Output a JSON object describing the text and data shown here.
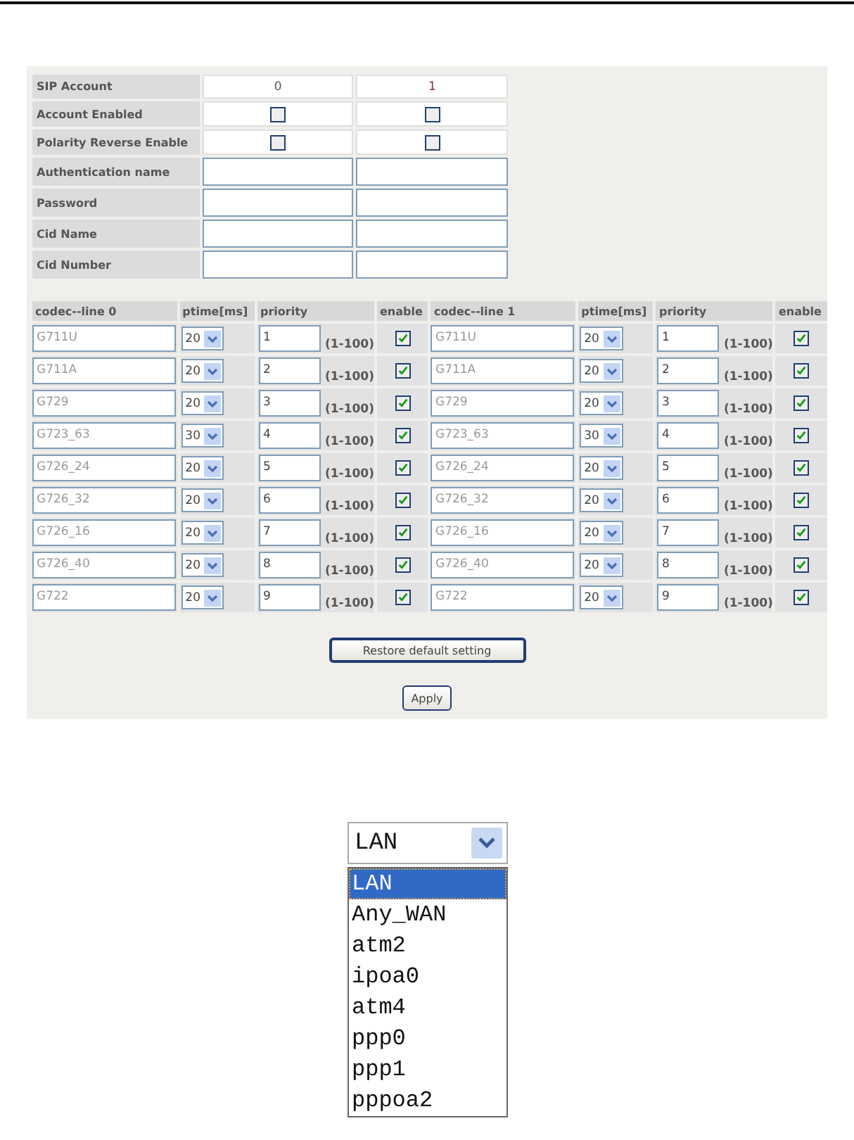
{
  "account_table": {
    "header": {
      "label": "SIP Account",
      "columns": [
        "0",
        "1"
      ]
    },
    "rows": [
      {
        "label": "Account Enabled",
        "kind": "checkbox",
        "cells": [
          {
            "checked": false
          },
          {
            "checked": false
          }
        ]
      },
      {
        "label": "Polarity Reverse Enable",
        "kind": "checkbox",
        "cells": [
          {
            "checked": false
          },
          {
            "checked": false
          }
        ]
      },
      {
        "label": "Authentication name",
        "kind": "text"
      },
      {
        "label": "Password",
        "kind": "text"
      },
      {
        "label": "Cid Name",
        "kind": "text"
      },
      {
        "label": "Cid Number",
        "kind": "text"
      }
    ]
  },
  "codec_table": {
    "lines": [
      {
        "columns": [
          "codec--line 0",
          "ptime[ms]",
          "priority",
          "enable"
        ]
      },
      {
        "columns": [
          "codec--line 1",
          "ptime[ms]",
          "priority",
          "enable"
        ]
      }
    ],
    "rows": [
      [
        {
          "codec": "G711U",
          "ptime": "20",
          "priority": "1",
          "range": "(1-100)",
          "enabled": true
        },
        {
          "codec": "G711U",
          "ptime": "20",
          "priority": "1",
          "range": "(1-100)",
          "enabled": true
        }
      ],
      [
        {
          "codec": "G711A",
          "ptime": "20",
          "priority": "2",
          "range": "(1-100)",
          "enabled": true
        },
        {
          "codec": "G711A",
          "ptime": "20",
          "priority": "2",
          "range": "(1-100)",
          "enabled": true
        }
      ],
      [
        {
          "codec": "G729",
          "ptime": "20",
          "priority": "3",
          "range": "(1-100)",
          "enabled": true
        },
        {
          "codec": "G729",
          "ptime": "20",
          "priority": "3",
          "range": "(1-100)",
          "enabled": true
        }
      ],
      [
        {
          "codec": "G723_63",
          "ptime": "30",
          "priority": "4",
          "range": "(1-100)",
          "enabled": true
        },
        {
          "codec": "G723_63",
          "ptime": "30",
          "priority": "4",
          "range": "(1-100)",
          "enabled": true
        }
      ],
      [
        {
          "codec": "G726_24",
          "ptime": "20",
          "priority": "5",
          "range": "(1-100)",
          "enabled": true
        },
        {
          "codec": "G726_24",
          "ptime": "20",
          "priority": "5",
          "range": "(1-100)",
          "enabled": true
        }
      ],
      [
        {
          "codec": "G726_32",
          "ptime": "20",
          "priority": "6",
          "range": "(1-100)",
          "enabled": true
        },
        {
          "codec": "G726_32",
          "ptime": "20",
          "priority": "6",
          "range": "(1-100)",
          "enabled": true
        }
      ],
      [
        {
          "codec": "G726_16",
          "ptime": "20",
          "priority": "7",
          "range": "(1-100)",
          "enabled": true
        },
        {
          "codec": "G726_16",
          "ptime": "20",
          "priority": "7",
          "range": "(1-100)",
          "enabled": true
        }
      ],
      [
        {
          "codec": "G726_40",
          "ptime": "20",
          "priority": "8",
          "range": "(1-100)",
          "enabled": true
        },
        {
          "codec": "G726_40",
          "ptime": "20",
          "priority": "8",
          "range": "(1-100)",
          "enabled": true
        }
      ],
      [
        {
          "codec": "G722",
          "ptime": "20",
          "priority": "9",
          "range": "(1-100)",
          "enabled": true
        },
        {
          "codec": "G722",
          "ptime": "20",
          "priority": "9",
          "range": "(1-100)",
          "enabled": true
        }
      ]
    ]
  },
  "buttons": [
    "Restore default setting",
    "Apply"
  ],
  "interface_dropdown": {
    "value": "LAN",
    "options": [
      {
        "label": "LAN",
        "selected": true
      },
      {
        "label": "Any_WAN",
        "selected": false
      },
      {
        "label": "atm2",
        "selected": false
      },
      {
        "label": "ipoa0",
        "selected": false
      },
      {
        "label": "atm4",
        "selected": false
      },
      {
        "label": "ppp0",
        "selected": false
      },
      {
        "label": "ppp1",
        "selected": false
      },
      {
        "label": "pppoa2",
        "selected": false
      }
    ]
  }
}
